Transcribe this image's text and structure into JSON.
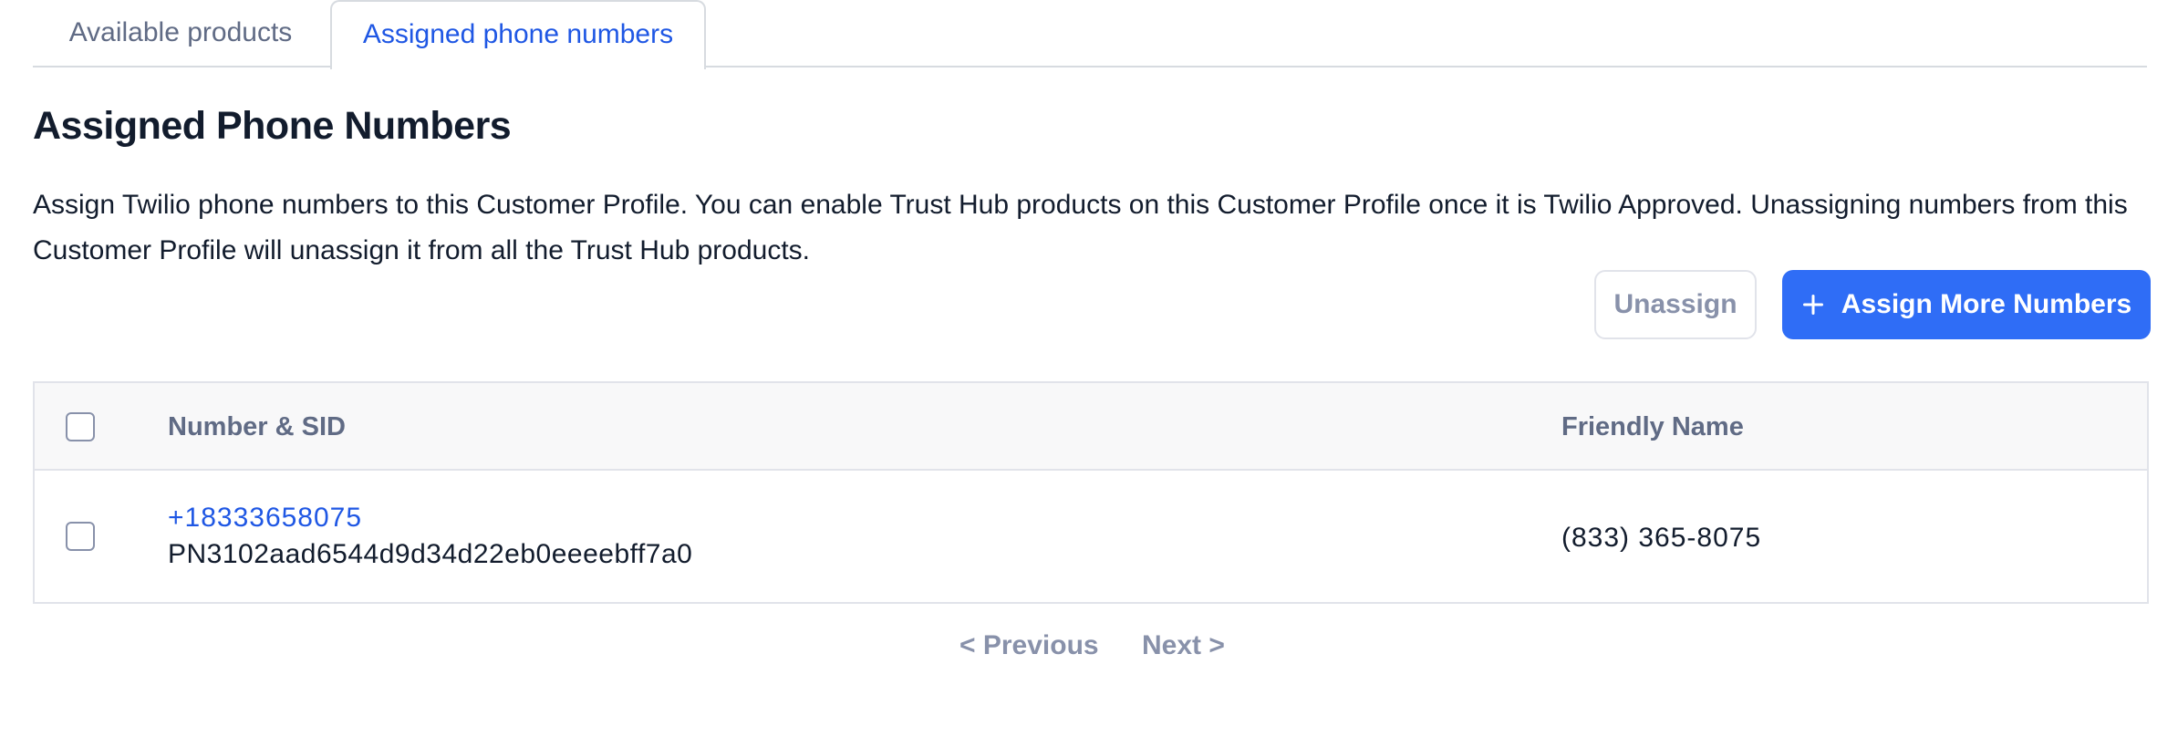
{
  "tabs": [
    {
      "label": "Available products",
      "active": false
    },
    {
      "label": "Assigned phone numbers",
      "active": true
    }
  ],
  "section": {
    "title": "Assigned Phone Numbers",
    "description": "Assign Twilio phone numbers to this Customer Profile. You can enable Trust Hub products on this Customer Profile once it is Twilio Approved. Unassigning numbers from this Customer Profile will unassign it from all the Trust Hub products."
  },
  "actions": {
    "unassign_label": "Unassign",
    "assign_label": "Assign More Numbers",
    "assign_icon": "plus-icon"
  },
  "table": {
    "columns": [
      "Number & SID",
      "Friendly Name"
    ],
    "rows": [
      {
        "number": "+18333658075",
        "sid": "PN3102aad6544d9d34d22eb0eeeebff7a0",
        "friendly_name": "(833) 365-8075",
        "checked": false
      }
    ]
  },
  "pagination": {
    "previous_label": "< Previous",
    "next_label": "Next >"
  },
  "colors": {
    "accent": "#2f6df6",
    "link": "#1f57e4",
    "muted": "#606b85",
    "disabled": "#8891aa"
  }
}
